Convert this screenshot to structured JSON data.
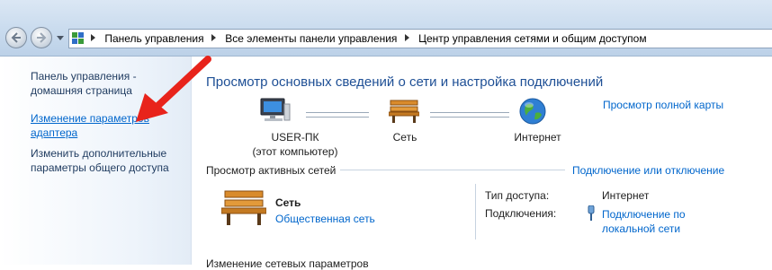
{
  "breadcrumb": {
    "items": [
      "Панель управления",
      "Все элементы панели управления",
      "Центр управления сетями и общим доступом"
    ]
  },
  "left_pane": {
    "home_link": "Панель управления - домашняя страница",
    "adapter_link": "Изменение параметров адаптера",
    "sharing_link": "Изменить дополнительные параметры общего доступа"
  },
  "main": {
    "title": "Просмотр основных сведений о сети и настройка подключений",
    "full_map_link": "Просмотр полной карты",
    "map": {
      "computer_name": "USER-ПК",
      "computer_sub": "(этот компьютер)",
      "network": "Сеть",
      "internet": "Интернет"
    },
    "active_networks_title": "Просмотр активных сетей",
    "connect_link": "Подключение или отключение",
    "network_name": "Сеть",
    "network_type": "Общественная сеть",
    "access_type_label": "Тип доступа:",
    "access_type_value": "Интернет",
    "connections_label": "Подключения:",
    "connections_value": "Подключение по локальной сети",
    "change_settings_title": "Изменение сетевых параметров"
  },
  "colors": {
    "link": "#0066cc",
    "title": "#1e4f95",
    "arrow": "#e8231b"
  },
  "icons": [
    "back-arrow-icon",
    "forward-arrow-icon",
    "control-panel-icon",
    "computer-icon",
    "bench-icon",
    "globe-icon",
    "plug-icon"
  ]
}
